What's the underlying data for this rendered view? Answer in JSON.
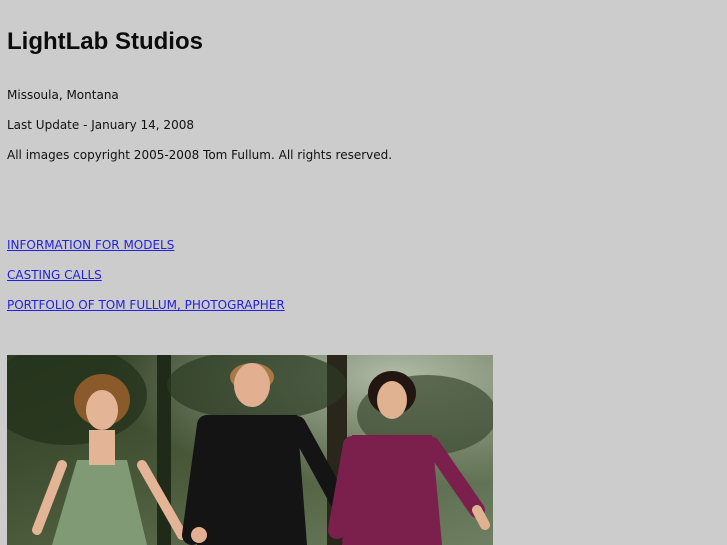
{
  "site_title": "LightLab Studios",
  "location": "Missoula, Montana",
  "last_update": "Last Update - January 14, 2008",
  "copyright": "All images copyright 2005-2008 Tom Fullum. All rights reserved.",
  "links": [
    {
      "label": "INFORMATION FOR MODELS"
    },
    {
      "label": "CASTING CALLS"
    },
    {
      "label": "PORTFOLIO OF TOM FULLUM, PHOTOGRAPHER"
    }
  ],
  "colors": {
    "background": "#cccccc",
    "link": "#2222dd"
  }
}
